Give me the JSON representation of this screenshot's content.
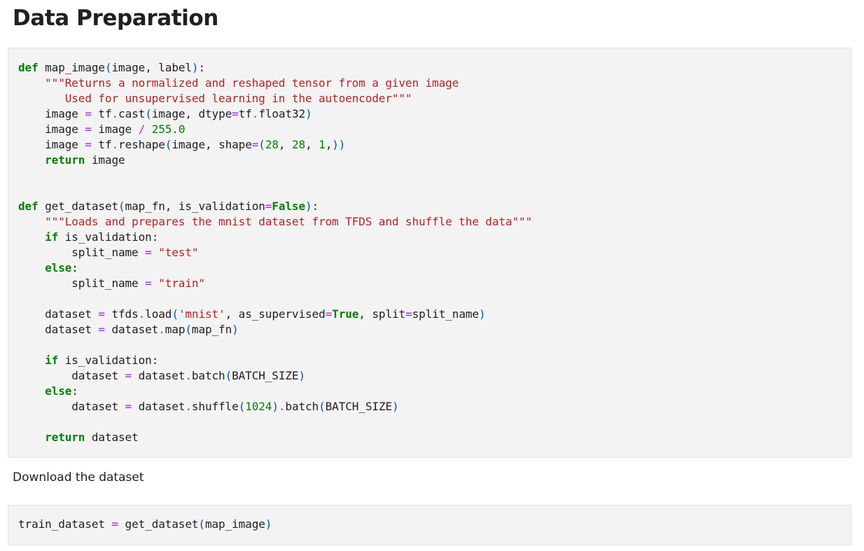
{
  "heading": "Data Preparation",
  "markdown_text": "Download the dataset",
  "colors": {
    "keyword": "#008000",
    "string": "#ba2121",
    "number": "#008000",
    "operator": "#aa22ff",
    "bracket": "#0055aa",
    "cell_background": "#f3f3f3"
  },
  "code_cells": [
    {
      "lines": [
        [
          [
            "kw",
            "def"
          ],
          [
            "nm",
            " map_image"
          ],
          [
            "br",
            "("
          ],
          [
            "nm",
            "image"
          ],
          [
            "punc",
            ","
          ],
          [
            "nm",
            " label"
          ],
          [
            "br",
            ")"
          ],
          [
            "punc",
            ":"
          ]
        ],
        [
          [
            "nm",
            "    "
          ],
          [
            "str",
            "\"\"\"Returns a normalized and reshaped tensor from a given image"
          ]
        ],
        [
          [
            "str",
            "       Used for unsupervised learning in the autoencoder\"\"\""
          ]
        ],
        [
          [
            "nm",
            "    image "
          ],
          [
            "op",
            "="
          ],
          [
            "nm",
            " tf"
          ],
          [
            "op",
            "."
          ],
          [
            "nm",
            "cast"
          ],
          [
            "br",
            "("
          ],
          [
            "nm",
            "image"
          ],
          [
            "punc",
            ","
          ],
          [
            "nm",
            " dtype"
          ],
          [
            "op",
            "="
          ],
          [
            "nm",
            "tf"
          ],
          [
            "op",
            "."
          ],
          [
            "nm",
            "float32"
          ],
          [
            "br",
            ")"
          ]
        ],
        [
          [
            "nm",
            "    image "
          ],
          [
            "op",
            "="
          ],
          [
            "nm",
            " image "
          ],
          [
            "op",
            "/"
          ],
          [
            "num",
            " 255.0"
          ]
        ],
        [
          [
            "nm",
            "    image "
          ],
          [
            "op",
            "="
          ],
          [
            "nm",
            " tf"
          ],
          [
            "op",
            "."
          ],
          [
            "nm",
            "reshape"
          ],
          [
            "br",
            "("
          ],
          [
            "nm",
            "image"
          ],
          [
            "punc",
            ","
          ],
          [
            "nm",
            " shape"
          ],
          [
            "op",
            "="
          ],
          [
            "br",
            "("
          ],
          [
            "num",
            "28"
          ],
          [
            "punc",
            ","
          ],
          [
            "num",
            " 28"
          ],
          [
            "punc",
            ","
          ],
          [
            "num",
            " 1"
          ],
          [
            "punc",
            ","
          ],
          [
            "br",
            "))"
          ]
        ],
        [
          [
            "nm",
            "    "
          ],
          [
            "kw",
            "return"
          ],
          [
            "nm",
            " image"
          ]
        ],
        [],
        [],
        [
          [
            "kw",
            "def"
          ],
          [
            "nm",
            " get_dataset"
          ],
          [
            "br",
            "("
          ],
          [
            "nm",
            "map_fn"
          ],
          [
            "punc",
            ","
          ],
          [
            "nm",
            " is_validation"
          ],
          [
            "op",
            "="
          ],
          [
            "kw",
            "False"
          ],
          [
            "br",
            ")"
          ],
          [
            "punc",
            ":"
          ]
        ],
        [
          [
            "nm",
            "    "
          ],
          [
            "str",
            "\"\"\"Loads and prepares the mnist dataset from TFDS and shuffle the data\"\"\""
          ]
        ],
        [
          [
            "nm",
            "    "
          ],
          [
            "kw",
            "if"
          ],
          [
            "nm",
            " is_validation"
          ],
          [
            "punc",
            ":"
          ]
        ],
        [
          [
            "nm",
            "        split_name "
          ],
          [
            "op",
            "="
          ],
          [
            "str",
            " \"test\""
          ]
        ],
        [
          [
            "nm",
            "    "
          ],
          [
            "kw",
            "else"
          ],
          [
            "punc",
            ":"
          ]
        ],
        [
          [
            "nm",
            "        split_name "
          ],
          [
            "op",
            "="
          ],
          [
            "str",
            " \"train\""
          ]
        ],
        [],
        [
          [
            "nm",
            "    dataset "
          ],
          [
            "op",
            "="
          ],
          [
            "nm",
            " tfds"
          ],
          [
            "op",
            "."
          ],
          [
            "nm",
            "load"
          ],
          [
            "br",
            "("
          ],
          [
            "str",
            "'mnist'"
          ],
          [
            "punc",
            ","
          ],
          [
            "nm",
            " as_supervised"
          ],
          [
            "op",
            "="
          ],
          [
            "kw",
            "True"
          ],
          [
            "punc",
            ","
          ],
          [
            "nm",
            " split"
          ],
          [
            "op",
            "="
          ],
          [
            "nm",
            "split_name"
          ],
          [
            "br",
            ")"
          ]
        ],
        [
          [
            "nm",
            "    dataset "
          ],
          [
            "op",
            "="
          ],
          [
            "nm",
            " dataset"
          ],
          [
            "op",
            "."
          ],
          [
            "nm",
            "map"
          ],
          [
            "br",
            "("
          ],
          [
            "nm",
            "map_fn"
          ],
          [
            "br",
            ")"
          ]
        ],
        [],
        [
          [
            "nm",
            "    "
          ],
          [
            "kw",
            "if"
          ],
          [
            "nm",
            " is_validation"
          ],
          [
            "punc",
            ":"
          ]
        ],
        [
          [
            "nm",
            "        dataset "
          ],
          [
            "op",
            "="
          ],
          [
            "nm",
            " dataset"
          ],
          [
            "op",
            "."
          ],
          [
            "nm",
            "batch"
          ],
          [
            "br",
            "("
          ],
          [
            "nm",
            "BATCH_SIZE"
          ],
          [
            "br",
            ")"
          ]
        ],
        [
          [
            "nm",
            "    "
          ],
          [
            "kw",
            "else"
          ],
          [
            "punc",
            ":"
          ]
        ],
        [
          [
            "nm",
            "        dataset "
          ],
          [
            "op",
            "="
          ],
          [
            "nm",
            " dataset"
          ],
          [
            "op",
            "."
          ],
          [
            "nm",
            "shuffle"
          ],
          [
            "br",
            "("
          ],
          [
            "num",
            "1024"
          ],
          [
            "br",
            ")"
          ],
          [
            "op",
            "."
          ],
          [
            "nm",
            "batch"
          ],
          [
            "br",
            "("
          ],
          [
            "nm",
            "BATCH_SIZE"
          ],
          [
            "br",
            ")"
          ]
        ],
        [],
        [
          [
            "nm",
            "    "
          ],
          [
            "kw",
            "return"
          ],
          [
            "nm",
            " dataset"
          ]
        ]
      ]
    },
    {
      "lines": [
        [
          [
            "nm",
            "train_dataset "
          ],
          [
            "op",
            "="
          ],
          [
            "nm",
            " get_dataset"
          ],
          [
            "br",
            "("
          ],
          [
            "nm",
            "map_image"
          ],
          [
            "br",
            ")"
          ]
        ]
      ]
    }
  ]
}
